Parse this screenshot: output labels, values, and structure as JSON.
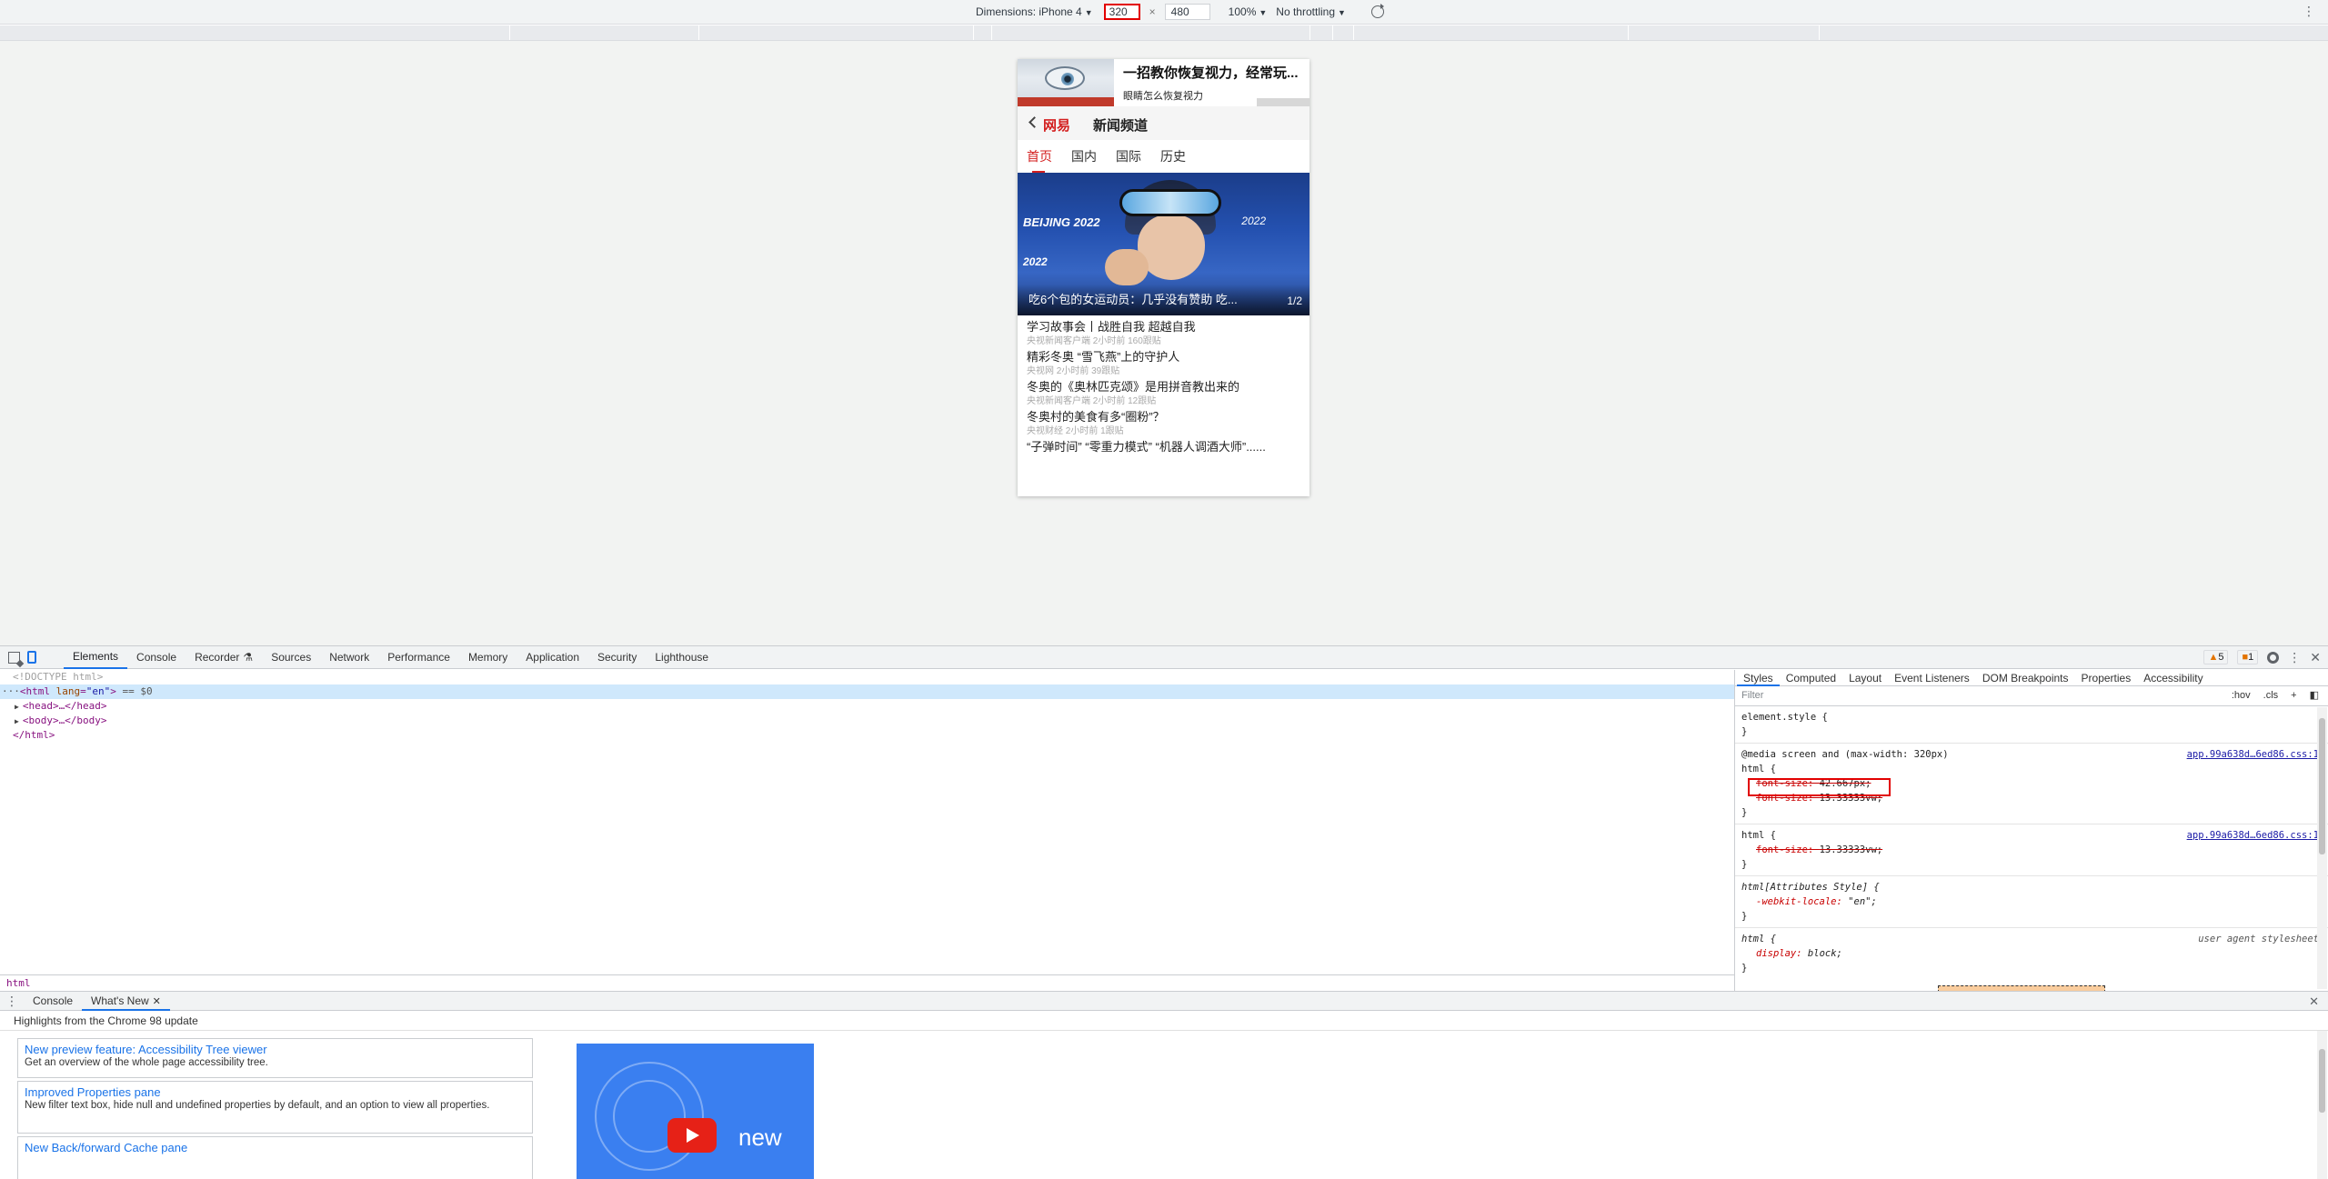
{
  "device_toolbar": {
    "dimensions_label": "Dimensions: iPhone 4",
    "width": "320",
    "times": "×",
    "height": "480",
    "zoom": "100%",
    "throttling": "No throttling"
  },
  "phone": {
    "ad": {
      "title": "一招教你恢复视力，经常玩...",
      "subtitle": "眼睛怎么恢复视力"
    },
    "nav": {
      "logo": "网易",
      "title": "新闻频道"
    },
    "tabs": [
      "首页",
      "国内",
      "国际",
      "历史"
    ],
    "hero": {
      "overlay_1": "BEIJING 2022",
      "overlay_2": "2022",
      "overlay_3": "2022",
      "caption": "吃6个包的女运动员：几乎没有赞助 吃...",
      "page": "1/2"
    },
    "news": [
      {
        "title": "学习故事会丨战胜自我 超越自我",
        "meta": "央视新闻客户端 2小时前 160跟贴"
      },
      {
        "title": "精彩冬奥 “雪飞燕”上的守护人",
        "meta": "央视网 2小时前 39跟贴"
      },
      {
        "title": "冬奥的《奥林匹克颂》是用拼音教出来的",
        "meta": "央视新闻客户端 2小时前 12跟贴"
      },
      {
        "title": "冬奥村的美食有多“圈粉”？",
        "meta": "央视财经 2小时前 1跟贴"
      },
      {
        "title": "“子弹时间” “零重力模式” “机器人调酒大师”......",
        "meta": ""
      }
    ]
  },
  "devtools": {
    "tabs": [
      "Elements",
      "Console",
      "Recorder",
      "Sources",
      "Network",
      "Performance",
      "Memory",
      "Application",
      "Security",
      "Lighthouse"
    ],
    "warnings": "5",
    "issues": "1",
    "dom": {
      "doctype": "<!DOCTYPE html>",
      "html_open": "<html lang=\"en\"> == $0",
      "html_tag": "html",
      "lang_attr": "lang",
      "lang_val": "\"en\"",
      "eq_sel": "== $0",
      "head": "<head>…</head>",
      "body": "<body>…</body>",
      "html_close": "</html>"
    },
    "breadcrumb": "html",
    "styles_tabs": [
      "Styles",
      "Computed",
      "Layout",
      "Event Listeners",
      "DOM Breakpoints",
      "Properties",
      "Accessibility"
    ],
    "filter_placeholder": "Filter",
    "filter_hov": ":hov",
    "filter_cls": ".cls",
    "rules": {
      "element_style": "element.style {",
      "close": "}",
      "media": "@media screen and (max-width: 320px)",
      "html_sel": "html {",
      "src_css": "app.99a638d…6ed86.css:1",
      "font_size_prop": "font-size",
      "fs_42": "42.667px;",
      "fs_vw": "13.33333vw;",
      "attrs_sel": "html[Attributes Style] {",
      "locale_prop": "-webkit-locale",
      "locale_val": "\"en\";",
      "ua_sel": "html {",
      "ua_src": "user agent stylesheet",
      "display_prop": "display",
      "display_val": "block;"
    },
    "drawer": {
      "tabs": [
        "Console",
        "What's New"
      ],
      "headline": "Highlights from the Chrome 98 update",
      "cards": [
        {
          "title": "New preview feature: Accessibility Tree viewer",
          "desc": "Get an overview of the whole page accessibility tree."
        },
        {
          "title": "Improved Properties pane",
          "desc": "New filter text box, hide null and undefined properties by default, and an option to view all properties."
        },
        {
          "title": "New Back/forward Cache pane",
          "desc": ""
        }
      ],
      "video_label": "new"
    }
  }
}
